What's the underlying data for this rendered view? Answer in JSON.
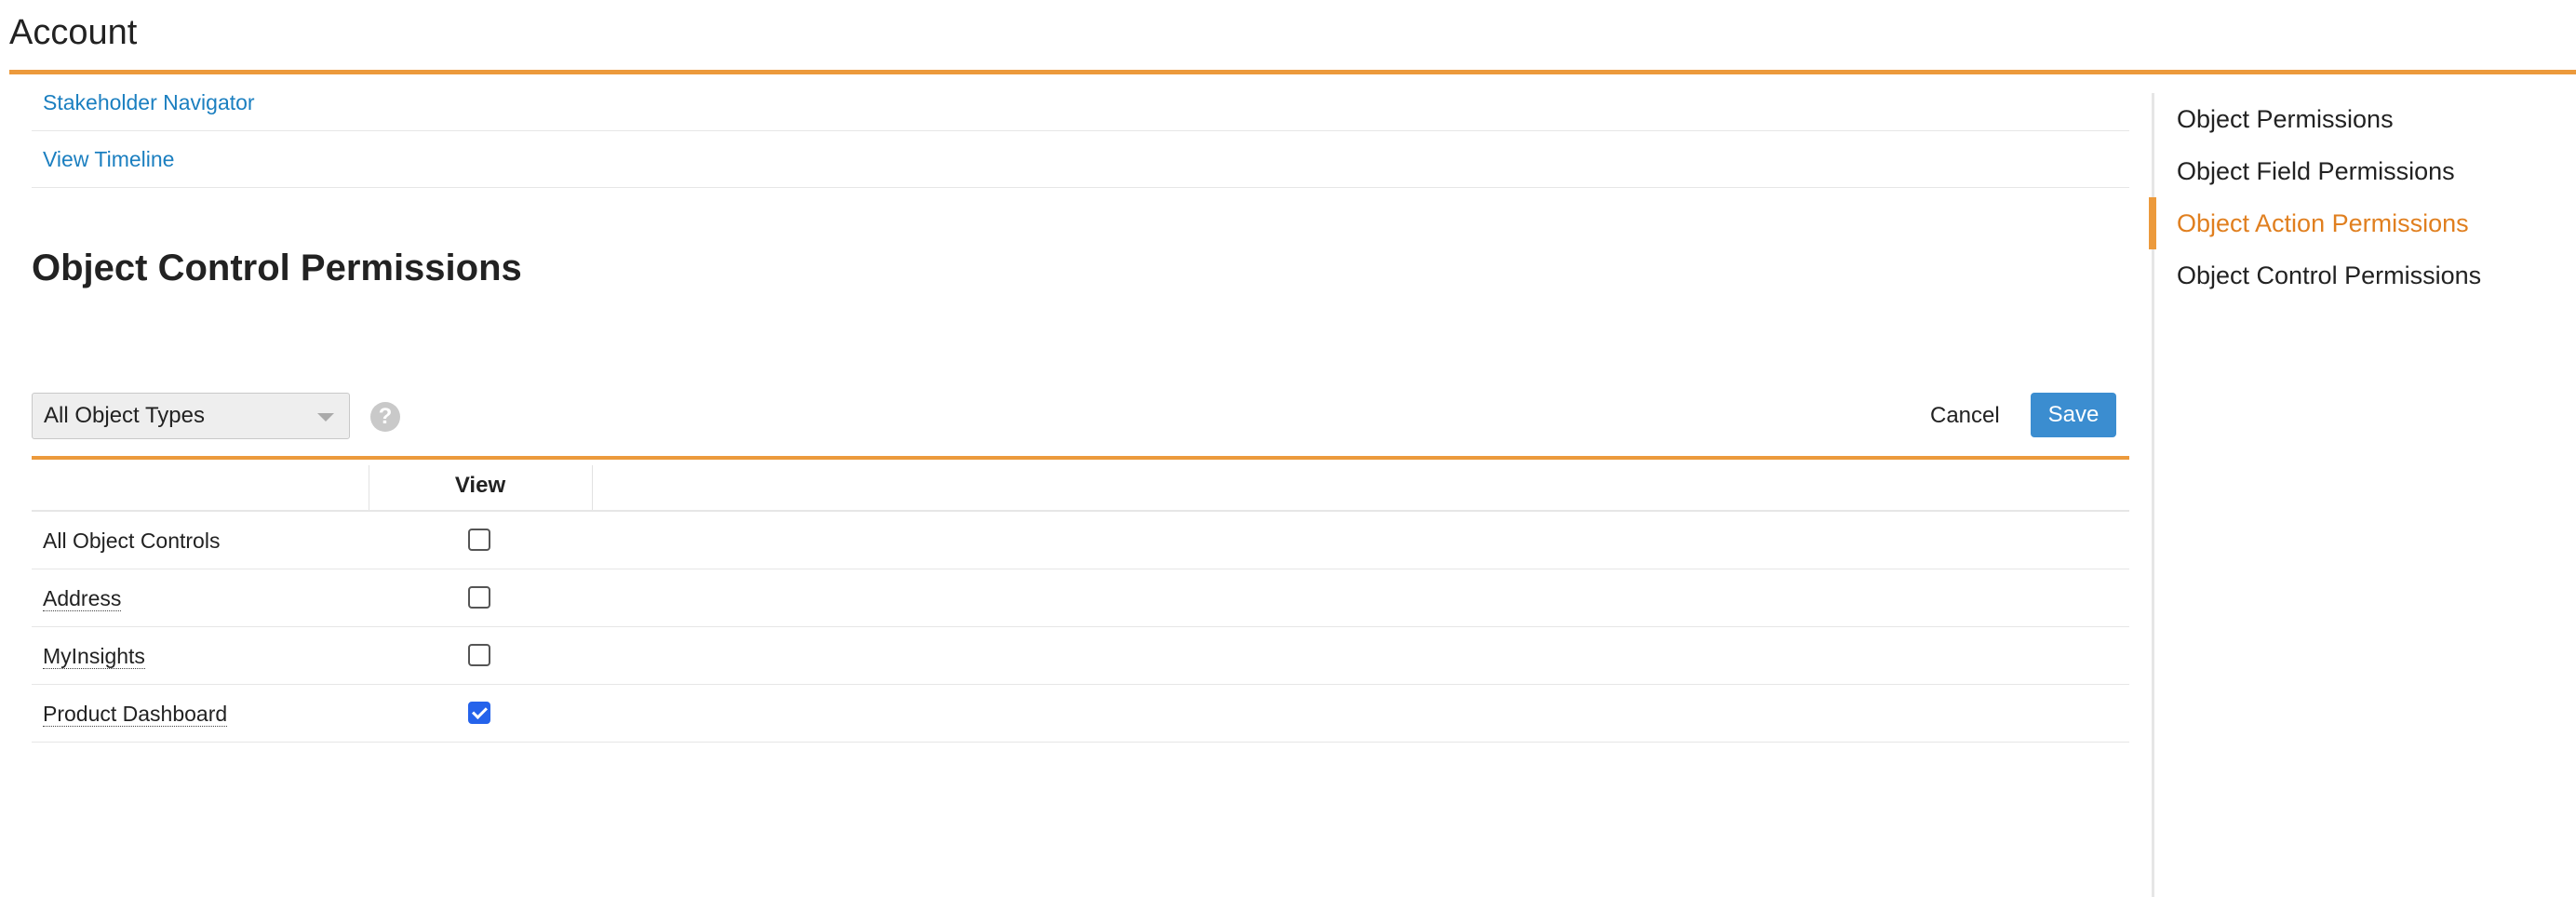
{
  "header": {
    "title": "Account"
  },
  "links": [
    {
      "label": "Stakeholder Navigator"
    },
    {
      "label": "View Timeline"
    }
  ],
  "section": {
    "title": "Object Control Permissions"
  },
  "toolbar": {
    "select_value": "All Object Types",
    "help_icon": "question-circle-icon",
    "cancel_label": "Cancel",
    "save_label": "Save"
  },
  "table": {
    "columns": [
      "",
      "View"
    ],
    "rows": [
      {
        "label": "All Object Controls",
        "view": false
      },
      {
        "label": "Address",
        "view": false
      },
      {
        "label": "MyInsights",
        "view": false
      },
      {
        "label": "Product Dashboard",
        "view": true
      }
    ]
  },
  "sidebar": {
    "items": [
      {
        "label": "Object Permissions"
      },
      {
        "label": "Object Field Permissions"
      },
      {
        "label": "Object Action Permissions"
      },
      {
        "label": "Object Control Permissions"
      }
    ],
    "active_index": 2
  },
  "colors": {
    "accent": "#ec9a3c",
    "link": "#1b7fc0",
    "primary": "#3b8dd0",
    "active": "#e07f1f"
  }
}
